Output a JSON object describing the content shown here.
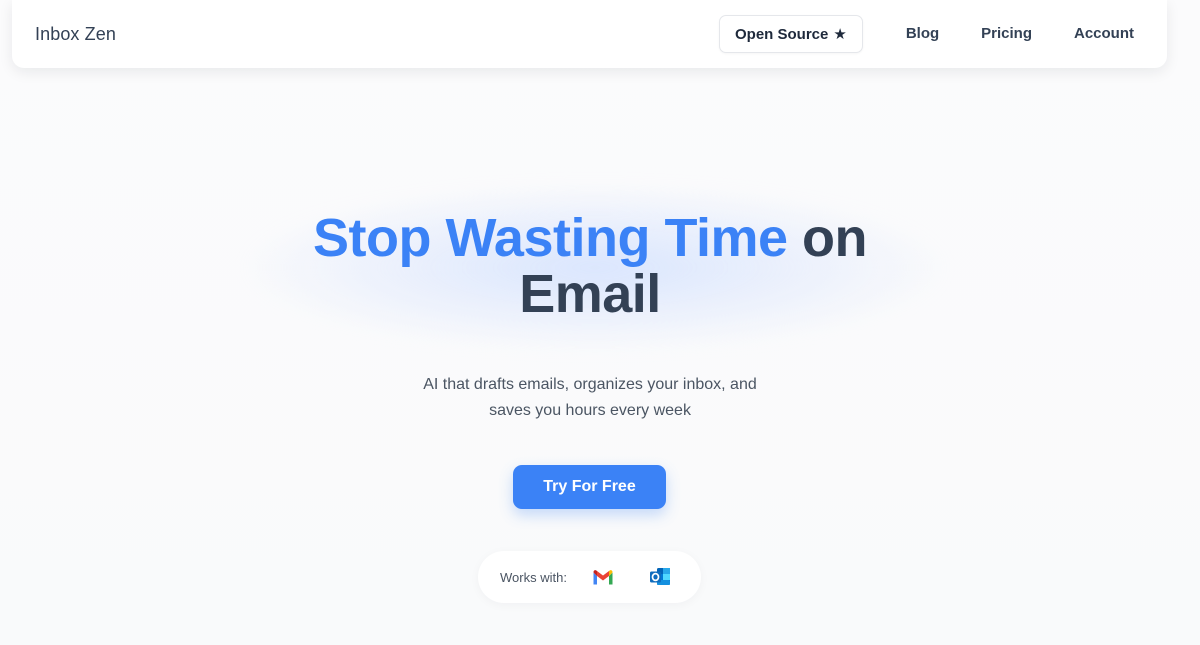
{
  "brand": {
    "name": "Inbox Zen"
  },
  "nav": {
    "open_source_label": "Open Source",
    "open_source_icon": "star-icon",
    "links": [
      "Blog",
      "Pricing",
      "Account"
    ]
  },
  "hero": {
    "headline_accent": "Stop Wasting Time",
    "headline_rest": "on",
    "headline_line2": "Email",
    "subtitle_line1": "AI that drafts emails, organizes your inbox, and",
    "subtitle_line2": "saves you hours every week",
    "cta_label": "Try For Free"
  },
  "integrations": {
    "label": "Works with:",
    "logos": [
      "gmail-icon",
      "outlook-icon"
    ]
  },
  "colors": {
    "accent": "#3b82f6",
    "heading": "#334155",
    "body_text": "#4b5563"
  }
}
